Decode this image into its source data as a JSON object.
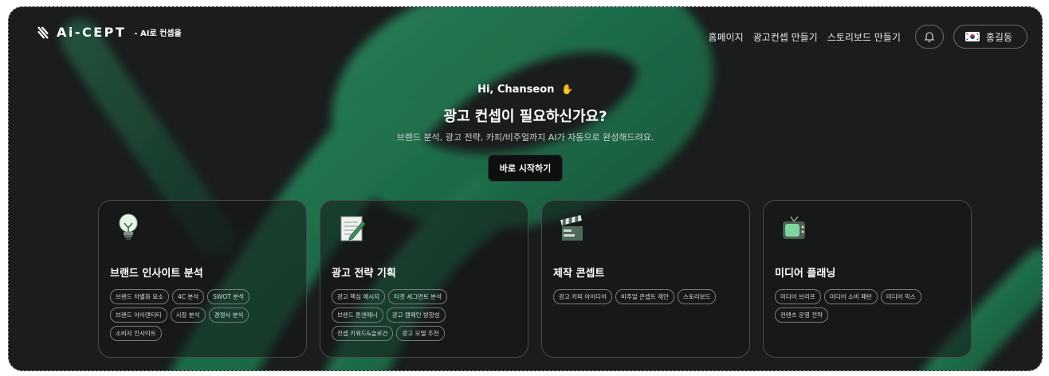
{
  "header": {
    "logo_text": "Ai-CEPT",
    "logo_sub": "- AI로 컨셉을",
    "nav": [
      "홈페이지",
      "광고컨셉 만들기",
      "스토리보드 만들기"
    ],
    "user_name": "홍길동"
  },
  "hero": {
    "greeting": "Hi, Chanseon",
    "headline": "광고 컨셉이 필요하신가요?",
    "subline": "브랜드 분석, 광고 전략, 카피/비주얼까지 AI가 자동으로 완성해드려요.",
    "cta": "바로 시작하기"
  },
  "cards": [
    {
      "title": "브랜드 인사이트 분석",
      "icon": "lightbulb-icon",
      "tags": [
        "브랜드 차별화 요소",
        "4C 분석",
        "SWOT 분석",
        "브랜드 아이덴티티",
        "시장 분석",
        "경쟁사 분석",
        "소비자 인사이트"
      ]
    },
    {
      "title": "광고 전략 기획",
      "icon": "memo-icon",
      "tags": [
        "광고 핵심 메시지",
        "타겟 세그먼트 분석",
        "브랜드 톤앤매너",
        "광고 캠페인 방향성",
        "컨셉 키워드&슬로건",
        "광고 모델 추천"
      ]
    },
    {
      "title": "제작 콘셉트",
      "icon": "clapperboard-icon",
      "tags": [
        "광고 카피 아이디어",
        "비주얼 콘셉트 제안",
        "스토리보드"
      ]
    },
    {
      "title": "미디어 플래닝",
      "icon": "television-icon",
      "tags": [
        "미디어 브리프",
        "미디어 소비 패턴",
        "미디어 믹스",
        "컨텐츠 운영 전략"
      ]
    }
  ],
  "colors": {
    "background": "#1b1d1c",
    "ribbon": "#1f7a52"
  }
}
